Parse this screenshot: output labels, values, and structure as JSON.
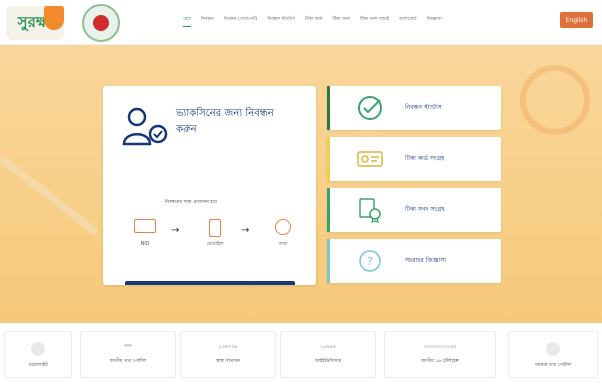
{
  "header": {
    "logo_text": "সুরক্ষা",
    "nav": [
      "হোম",
      "নিবন্ধন",
      "নিবন্ধন (পাসপোর্ট)",
      "নিবন্ধন স্ট্যাটাস",
      "টিকা কার্ড",
      "টিকা সনদ",
      "টিকা সনদ যাচাই",
      "ড্যাশবোর্ড",
      "জিজ্ঞাসা"
    ],
    "lang_button": "English"
  },
  "registration": {
    "title": "ভ্যাকসিনের জন্য নিবন্ধন করুন",
    "steps_caption": "নিবন্ধনের সময় প্রয়োজন হবে",
    "steps": [
      "NID",
      "মোবাইল",
      "তথ্য"
    ]
  },
  "side_cards": [
    {
      "label": "নিবন্ধন স্ট্যাটাস",
      "color": "#2b7a3b",
      "icon": "check-circle-icon"
    },
    {
      "label": "টিকা কার্ড সংগ্রহ",
      "color": "#e8d34a",
      "icon": "id-card-icon"
    },
    {
      "label": "টিকা সনদ সংগ্রহ",
      "color": "#3aa36b",
      "icon": "certificate-icon"
    },
    {
      "label": "সচরাচর জিজ্ঞাসা",
      "color": "#7bc6c9",
      "icon": "question-icon"
    }
  ],
  "footer": {
    "items": [
      {
        "value": "",
        "label": "ওয়েবসাইট"
      },
      {
        "value": "***",
        "label": "জাতীয় তথ্য পোর্টাল"
      },
      {
        "value": "১৩৬৩৭৮",
        "label": "স্বাস্থ্য বাতায়ন"
      },
      {
        "value": "১০৬৫৫",
        "label": "আইইডিসিআর"
      },
      {
        "value": "৩৩৩৩৩৩৩৩৩৩",
        "label": "জাতীয় ১৬ টেলিহেল্প"
      },
      {
        "value": "",
        "label": "সরকার তথ্য পোর্টাল"
      }
    ]
  }
}
